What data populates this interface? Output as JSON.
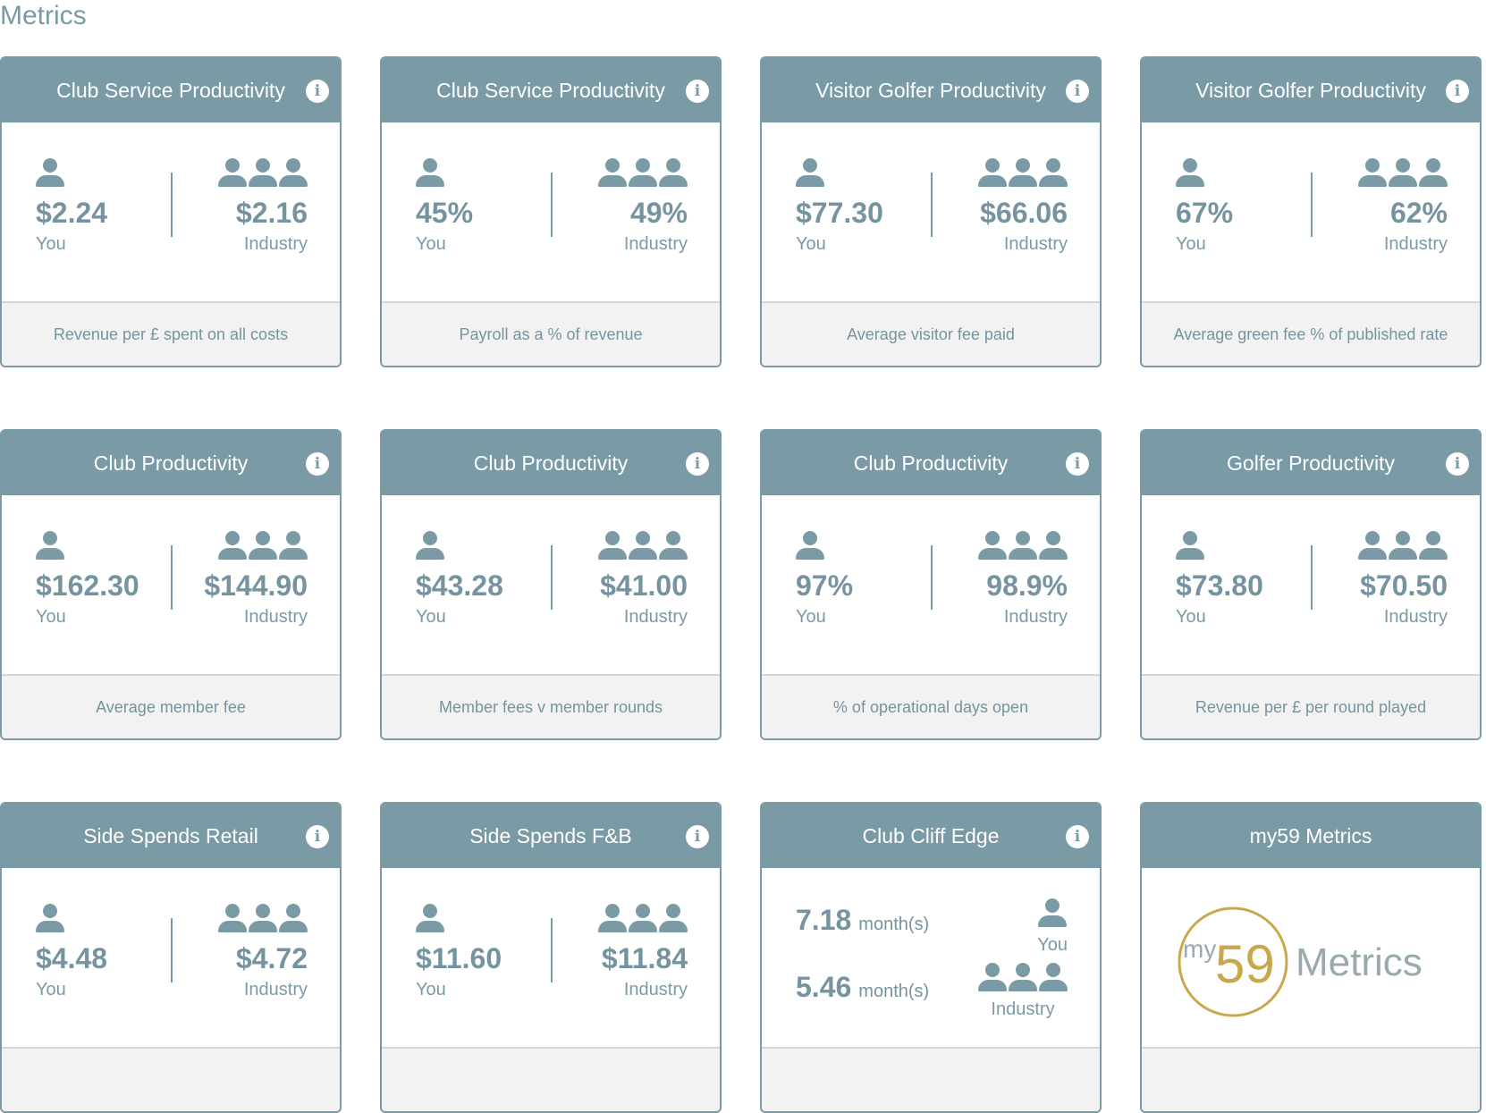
{
  "page_title": "Metrics",
  "labels": {
    "you": "You",
    "industry": "Industry"
  },
  "info_glyph": "i",
  "cards": [
    {
      "title": "Club Service Productivity",
      "you": "$2.24",
      "industry": "$2.16",
      "footer": "Revenue per £ spent on all costs"
    },
    {
      "title": "Club Service Productivity",
      "you": "45%",
      "industry": "49%",
      "footer": "Payroll as a % of revenue"
    },
    {
      "title": "Visitor Golfer Productivity",
      "you": "$77.30",
      "industry": "$66.06",
      "footer": "Average visitor fee paid"
    },
    {
      "title": "Visitor Golfer Productivity",
      "you": "67%",
      "industry": "62%",
      "footer": "Average green fee % of published rate"
    },
    {
      "title": "Club Productivity",
      "you": "$162.30",
      "industry": "$144.90",
      "footer": "Average member fee"
    },
    {
      "title": "Club Productivity",
      "you": "$43.28",
      "industry": "$41.00",
      "footer": "Member fees v member rounds"
    },
    {
      "title": "Club Productivity",
      "you": "97%",
      "industry": "98.9%",
      "footer": "% of operational days open"
    },
    {
      "title": "Golfer Productivity",
      "you": "$73.80",
      "industry": "$70.50",
      "footer": "Revenue per £ per round played"
    },
    {
      "title": "Side Spends Retail",
      "you": "$4.48",
      "industry": "$4.72",
      "footer": ""
    },
    {
      "title": "Side Spends F&B",
      "you": "$11.60",
      "industry": "$11.84",
      "footer": ""
    }
  ],
  "cliff": {
    "title": "Club Cliff Edge",
    "you_value": "7.18",
    "industry_value": "5.46",
    "unit": "month(s)"
  },
  "my59": {
    "title": "my59 Metrics",
    "logo_my": "my",
    "logo_num": "59",
    "logo_word": "Metrics"
  },
  "colors": {
    "accent": "#7a9aa5",
    "text": "#7594a0",
    "footer_bg": "#f2f2f2",
    "logo_gold": "#c9a84c"
  }
}
